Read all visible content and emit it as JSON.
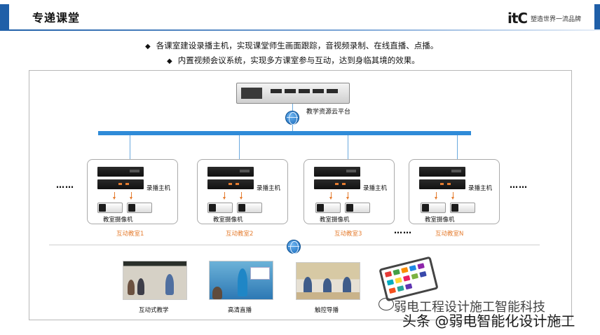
{
  "header": {
    "title": "专递课堂",
    "logo_text": "itC",
    "logo_slogan": "塑造世界一流品牌"
  },
  "bullets": [
    "各课室建设录播主机，实现课堂师生画面跟踪，音视频录制、在线直播、点播。",
    "内置视频会议系统，实现多方课室参与互动，达到身临其境的效果。"
  ],
  "bullet_marker": "◆",
  "diagram": {
    "cloud_label": "教学资源云平台",
    "recorder_label": "录播主机",
    "camera_label": "教室摄像机",
    "ellipsis": "……",
    "rooms": [
      {
        "name": "互动教室1"
      },
      {
        "name": "互动教室2"
      },
      {
        "name": "互动教室3"
      },
      {
        "name": "互动教室N"
      }
    ],
    "apps": [
      {
        "label": "互动式教学"
      },
      {
        "label": "高清直播"
      },
      {
        "label": "触控导播"
      }
    ]
  },
  "watermark": {
    "line1": "弱电工程设计施工智能科技",
    "line2": "头条 @弱电智能化设计施工"
  },
  "colors": {
    "brand_blue": "#1f5fa8",
    "bus_blue": "#2f8bd8",
    "room_orange": "#e57c2f"
  }
}
